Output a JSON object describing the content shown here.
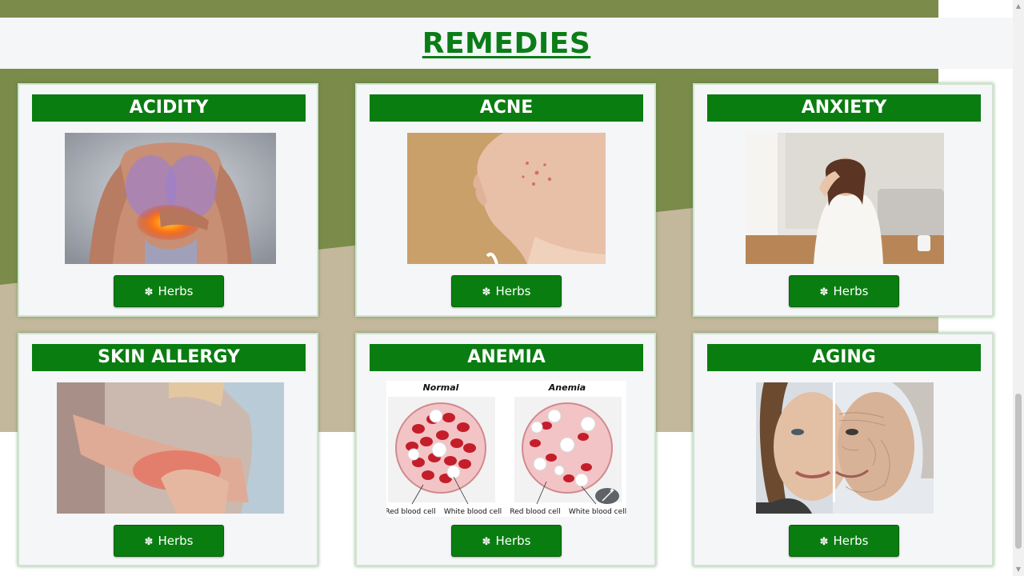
{
  "page": {
    "title": "REMEDIES"
  },
  "colors": {
    "olive": "#7a8b4a",
    "tan": "#c4b89c",
    "green": "#0a7d10",
    "card_bg": "#f4f6f8"
  },
  "cards": [
    {
      "title": "ACIDITY",
      "image": "acidity-illustration",
      "button": "Herbs",
      "button_icon": "leaf-icon"
    },
    {
      "title": "ACNE",
      "image": "acne-photo",
      "button": "Herbs",
      "button_icon": "leaf-icon"
    },
    {
      "title": "ANXIETY",
      "image": "anxiety-photo",
      "button": "Herbs",
      "button_icon": "leaf-icon"
    },
    {
      "title": "SKIN ALLERGY",
      "image": "skin-allergy-photo",
      "button": "Herbs",
      "button_icon": "leaf-icon"
    },
    {
      "title": "ANEMIA",
      "image": "anemia-diagram",
      "button": "Herbs",
      "button_icon": "leaf-icon",
      "diagram": {
        "normal": "Normal",
        "anemia": "Anemia",
        "rbc": "Red blood cell",
        "wbc": "White blood cell"
      }
    },
    {
      "title": "AGING",
      "image": "aging-photo",
      "button": "Herbs",
      "button_icon": "leaf-icon"
    }
  ]
}
